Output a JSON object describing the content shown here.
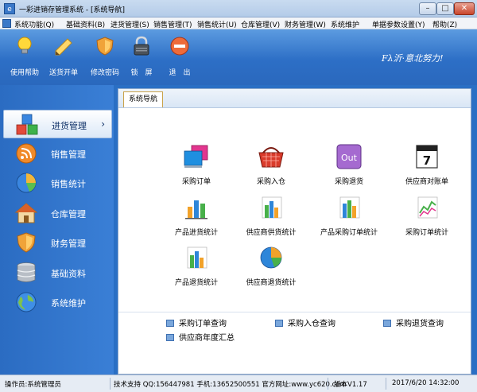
{
  "window": {
    "title": "一彩进销存管理系统 - [系统导航]",
    "buttons": [
      "–",
      "□",
      "✕"
    ]
  },
  "menu": [
    "系统功能(Q)",
    "基础资料(B)",
    "进货管理(S)",
    "销售管理(T)",
    "销售统计(U)",
    "仓库管理(V)",
    "财务管理(W)",
    "系统维护",
    "单据参数设置(Y)",
    "帮助(Z)"
  ],
  "mdi_buttons": [
    "_",
    "▭",
    "×"
  ],
  "toolbar": [
    {
      "label": "使用帮助",
      "icon": "bulb-icon"
    },
    {
      "label": "送货开单",
      "icon": "pencil-icon"
    },
    {
      "label": "修改密码",
      "icon": "shield-icon"
    },
    {
      "label": "锁　屏",
      "icon": "lock-icon"
    },
    {
      "label": "退　出",
      "icon": "exit-icon"
    }
  ],
  "slogan": "Fλ沂·意北努力!",
  "sidebar": [
    {
      "label": "进货管理",
      "icon": "cubes-icon",
      "arrow": "›"
    },
    {
      "label": "销售管理",
      "icon": "rss-icon"
    },
    {
      "label": "销售统计",
      "icon": "pie-chart-icon"
    },
    {
      "label": "仓库管理",
      "icon": "house-icon"
    },
    {
      "label": "财务管理",
      "icon": "shield-icon"
    },
    {
      "label": "基础资料",
      "icon": "database-icon"
    },
    {
      "label": "系统维护",
      "icon": "globe-icon"
    }
  ],
  "tab": "系统导航",
  "modules": [
    {
      "label": "采购订单",
      "icon": "cards-icon"
    },
    {
      "label": "采购入仓",
      "icon": "basket-icon"
    },
    {
      "label": "采购退货",
      "icon": "out-icon",
      "badge": "Out"
    },
    {
      "label": "供应商对账单",
      "icon": "calendar-icon",
      "badge": "7"
    },
    {
      "label": "产品进货统计",
      "icon": "bar-chart-icon"
    },
    {
      "label": "供应商供货统计",
      "icon": "bar-chart-icon"
    },
    {
      "label": "产品采购订单统计",
      "icon": "bar-chart-icon"
    },
    {
      "label": "采购订单统计",
      "icon": "line-chart-icon"
    },
    {
      "label": "产品退货统计",
      "icon": "bar-chart-icon"
    },
    {
      "label": "供应商退货统计",
      "icon": "pie-chart-icon"
    }
  ],
  "quick_links": [
    "采购订单查询",
    "采购入仓查询",
    "采购退货查询",
    "供应商年度汇总"
  ],
  "status": {
    "operator": "操作员:系统管理员",
    "support": "技术支持 QQ:156447981 手机:13652500551 官方网址:www.yc620.com",
    "version": "版本V1.17",
    "datetime": "2017/6/20 14:32:00"
  },
  "colors": {
    "toolbar_blue": "#2d6fc6",
    "sidebar_blue": "#3a7fd6",
    "tab_border": "#c9a24a"
  }
}
